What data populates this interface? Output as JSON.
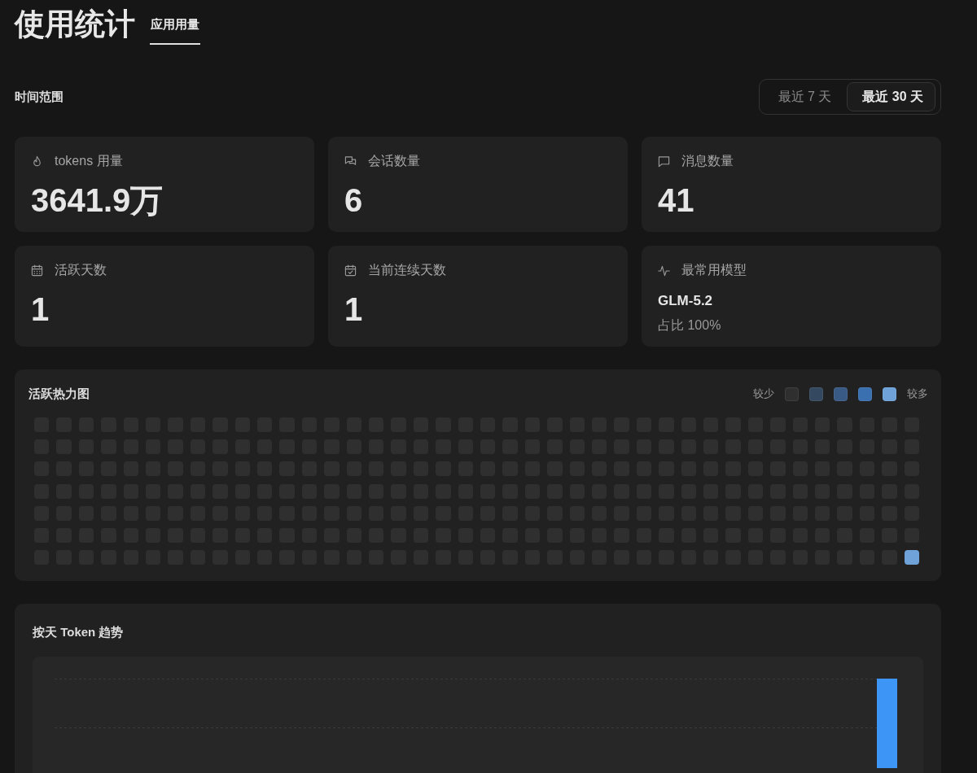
{
  "page": {
    "title": "使用统计"
  },
  "tabs": [
    {
      "label": "应用用量",
      "selected": true
    }
  ],
  "time_range": {
    "label": "时间范围",
    "options": [
      {
        "label": "最近 7 天",
        "selected": false
      },
      {
        "label": "最近 30 天",
        "selected": true
      }
    ]
  },
  "stat_cards": [
    {
      "kind": "count",
      "label": "tokens 用量",
      "value": "3641.9万"
    },
    {
      "kind": "count",
      "label": "会话数量",
      "value": "6"
    },
    {
      "kind": "count",
      "label": "消息数量",
      "value": "41"
    },
    {
      "kind": "count",
      "label": "活跃天数",
      "value": "1"
    },
    {
      "kind": "count",
      "label": "当前连续天数",
      "value": "1"
    },
    {
      "kind": "model",
      "label": "最常用模型",
      "model": "GLM-5.2",
      "share": "占比 100%"
    }
  ],
  "heatmap": {
    "title": "活跃热力图",
    "legend": {
      "less": "较少",
      "more": "较多",
      "swatches": [
        {
          "color": "#2f2f2f"
        },
        {
          "color": "#34495f"
        },
        {
          "color": "#395a85"
        },
        {
          "color": "#3a6fb0"
        },
        {
          "color": "#6ea2d9"
        }
      ]
    },
    "columns": [
      {
        "cells": [
          {
            "color": "#2f2f2f"
          },
          {
            "color": "#2f2f2f"
          },
          {
            "color": "#2f2f2f"
          },
          {
            "color": "#2f2f2f"
          },
          {
            "color": "#2f2f2f"
          },
          {
            "color": "#2f2f2f"
          },
          {
            "color": "#2f2f2f"
          }
        ]
      },
      {
        "cells": [
          {
            "color": "#2f2f2f"
          },
          {
            "color": "#2f2f2f"
          },
          {
            "color": "#2f2f2f"
          },
          {
            "color": "#2f2f2f"
          },
          {
            "color": "#2f2f2f"
          },
          {
            "color": "#2f2f2f"
          },
          {
            "color": "#2f2f2f"
          }
        ]
      },
      {
        "cells": [
          {
            "color": "#2f2f2f"
          },
          {
            "color": "#2f2f2f"
          },
          {
            "color": "#2f2f2f"
          },
          {
            "color": "#2f2f2f"
          },
          {
            "color": "#2f2f2f"
          },
          {
            "color": "#2f2f2f"
          },
          {
            "color": "#2f2f2f"
          }
        ]
      },
      {
        "cells": [
          {
            "color": "#2f2f2f"
          },
          {
            "color": "#2f2f2f"
          },
          {
            "color": "#2f2f2f"
          },
          {
            "color": "#2f2f2f"
          },
          {
            "color": "#2f2f2f"
          },
          {
            "color": "#2f2f2f"
          },
          {
            "color": "#2f2f2f"
          }
        ]
      },
      {
        "cells": [
          {
            "color": "#2f2f2f"
          },
          {
            "color": "#2f2f2f"
          },
          {
            "color": "#2f2f2f"
          },
          {
            "color": "#2f2f2f"
          },
          {
            "color": "#2f2f2f"
          },
          {
            "color": "#2f2f2f"
          },
          {
            "color": "#2f2f2f"
          }
        ]
      },
      {
        "cells": [
          {
            "color": "#2f2f2f"
          },
          {
            "color": "#2f2f2f"
          },
          {
            "color": "#2f2f2f"
          },
          {
            "color": "#2f2f2f"
          },
          {
            "color": "#2f2f2f"
          },
          {
            "color": "#2f2f2f"
          },
          {
            "color": "#2f2f2f"
          }
        ]
      },
      {
        "cells": [
          {
            "color": "#2f2f2f"
          },
          {
            "color": "#2f2f2f"
          },
          {
            "color": "#2f2f2f"
          },
          {
            "color": "#2f2f2f"
          },
          {
            "color": "#2f2f2f"
          },
          {
            "color": "#2f2f2f"
          },
          {
            "color": "#2f2f2f"
          }
        ]
      },
      {
        "cells": [
          {
            "color": "#2f2f2f"
          },
          {
            "color": "#2f2f2f"
          },
          {
            "color": "#2f2f2f"
          },
          {
            "color": "#2f2f2f"
          },
          {
            "color": "#2f2f2f"
          },
          {
            "color": "#2f2f2f"
          },
          {
            "color": "#2f2f2f"
          }
        ]
      },
      {
        "cells": [
          {
            "color": "#2f2f2f"
          },
          {
            "color": "#2f2f2f"
          },
          {
            "color": "#2f2f2f"
          },
          {
            "color": "#2f2f2f"
          },
          {
            "color": "#2f2f2f"
          },
          {
            "color": "#2f2f2f"
          },
          {
            "color": "#2f2f2f"
          }
        ]
      },
      {
        "cells": [
          {
            "color": "#2f2f2f"
          },
          {
            "color": "#2f2f2f"
          },
          {
            "color": "#2f2f2f"
          },
          {
            "color": "#2f2f2f"
          },
          {
            "color": "#2f2f2f"
          },
          {
            "color": "#2f2f2f"
          },
          {
            "color": "#2f2f2f"
          }
        ]
      },
      {
        "cells": [
          {
            "color": "#2f2f2f"
          },
          {
            "color": "#2f2f2f"
          },
          {
            "color": "#2f2f2f"
          },
          {
            "color": "#2f2f2f"
          },
          {
            "color": "#2f2f2f"
          },
          {
            "color": "#2f2f2f"
          },
          {
            "color": "#2f2f2f"
          }
        ]
      },
      {
        "cells": [
          {
            "color": "#2f2f2f"
          },
          {
            "color": "#2f2f2f"
          },
          {
            "color": "#2f2f2f"
          },
          {
            "color": "#2f2f2f"
          },
          {
            "color": "#2f2f2f"
          },
          {
            "color": "#2f2f2f"
          },
          {
            "color": "#2f2f2f"
          }
        ]
      },
      {
        "cells": [
          {
            "color": "#2f2f2f"
          },
          {
            "color": "#2f2f2f"
          },
          {
            "color": "#2f2f2f"
          },
          {
            "color": "#2f2f2f"
          },
          {
            "color": "#2f2f2f"
          },
          {
            "color": "#2f2f2f"
          },
          {
            "color": "#2f2f2f"
          }
        ]
      },
      {
        "cells": [
          {
            "color": "#2f2f2f"
          },
          {
            "color": "#2f2f2f"
          },
          {
            "color": "#2f2f2f"
          },
          {
            "color": "#2f2f2f"
          },
          {
            "color": "#2f2f2f"
          },
          {
            "color": "#2f2f2f"
          },
          {
            "color": "#2f2f2f"
          }
        ]
      },
      {
        "cells": [
          {
            "color": "#2f2f2f"
          },
          {
            "color": "#2f2f2f"
          },
          {
            "color": "#2f2f2f"
          },
          {
            "color": "#2f2f2f"
          },
          {
            "color": "#2f2f2f"
          },
          {
            "color": "#2f2f2f"
          },
          {
            "color": "#2f2f2f"
          }
        ]
      },
      {
        "cells": [
          {
            "color": "#2f2f2f"
          },
          {
            "color": "#2f2f2f"
          },
          {
            "color": "#2f2f2f"
          },
          {
            "color": "#2f2f2f"
          },
          {
            "color": "#2f2f2f"
          },
          {
            "color": "#2f2f2f"
          },
          {
            "color": "#2f2f2f"
          }
        ]
      },
      {
        "cells": [
          {
            "color": "#2f2f2f"
          },
          {
            "color": "#2f2f2f"
          },
          {
            "color": "#2f2f2f"
          },
          {
            "color": "#2f2f2f"
          },
          {
            "color": "#2f2f2f"
          },
          {
            "color": "#2f2f2f"
          },
          {
            "color": "#2f2f2f"
          }
        ]
      },
      {
        "cells": [
          {
            "color": "#2f2f2f"
          },
          {
            "color": "#2f2f2f"
          },
          {
            "color": "#2f2f2f"
          },
          {
            "color": "#2f2f2f"
          },
          {
            "color": "#2f2f2f"
          },
          {
            "color": "#2f2f2f"
          },
          {
            "color": "#2f2f2f"
          }
        ]
      },
      {
        "cells": [
          {
            "color": "#2f2f2f"
          },
          {
            "color": "#2f2f2f"
          },
          {
            "color": "#2f2f2f"
          },
          {
            "color": "#2f2f2f"
          },
          {
            "color": "#2f2f2f"
          },
          {
            "color": "#2f2f2f"
          },
          {
            "color": "#2f2f2f"
          }
        ]
      },
      {
        "cells": [
          {
            "color": "#2f2f2f"
          },
          {
            "color": "#2f2f2f"
          },
          {
            "color": "#2f2f2f"
          },
          {
            "color": "#2f2f2f"
          },
          {
            "color": "#2f2f2f"
          },
          {
            "color": "#2f2f2f"
          },
          {
            "color": "#2f2f2f"
          }
        ]
      },
      {
        "cells": [
          {
            "color": "#2f2f2f"
          },
          {
            "color": "#2f2f2f"
          },
          {
            "color": "#2f2f2f"
          },
          {
            "color": "#2f2f2f"
          },
          {
            "color": "#2f2f2f"
          },
          {
            "color": "#2f2f2f"
          },
          {
            "color": "#2f2f2f"
          }
        ]
      },
      {
        "cells": [
          {
            "color": "#2f2f2f"
          },
          {
            "color": "#2f2f2f"
          },
          {
            "color": "#2f2f2f"
          },
          {
            "color": "#2f2f2f"
          },
          {
            "color": "#2f2f2f"
          },
          {
            "color": "#2f2f2f"
          },
          {
            "color": "#2f2f2f"
          }
        ]
      },
      {
        "cells": [
          {
            "color": "#2f2f2f"
          },
          {
            "color": "#2f2f2f"
          },
          {
            "color": "#2f2f2f"
          },
          {
            "color": "#2f2f2f"
          },
          {
            "color": "#2f2f2f"
          },
          {
            "color": "#2f2f2f"
          },
          {
            "color": "#2f2f2f"
          }
        ]
      },
      {
        "cells": [
          {
            "color": "#2f2f2f"
          },
          {
            "color": "#2f2f2f"
          },
          {
            "color": "#2f2f2f"
          },
          {
            "color": "#2f2f2f"
          },
          {
            "color": "#2f2f2f"
          },
          {
            "color": "#2f2f2f"
          },
          {
            "color": "#2f2f2f"
          }
        ]
      },
      {
        "cells": [
          {
            "color": "#2f2f2f"
          },
          {
            "color": "#2f2f2f"
          },
          {
            "color": "#2f2f2f"
          },
          {
            "color": "#2f2f2f"
          },
          {
            "color": "#2f2f2f"
          },
          {
            "color": "#2f2f2f"
          },
          {
            "color": "#2f2f2f"
          }
        ]
      },
      {
        "cells": [
          {
            "color": "#2f2f2f"
          },
          {
            "color": "#2f2f2f"
          },
          {
            "color": "#2f2f2f"
          },
          {
            "color": "#2f2f2f"
          },
          {
            "color": "#2f2f2f"
          },
          {
            "color": "#2f2f2f"
          },
          {
            "color": "#2f2f2f"
          }
        ]
      },
      {
        "cells": [
          {
            "color": "#2f2f2f"
          },
          {
            "color": "#2f2f2f"
          },
          {
            "color": "#2f2f2f"
          },
          {
            "color": "#2f2f2f"
          },
          {
            "color": "#2f2f2f"
          },
          {
            "color": "#2f2f2f"
          },
          {
            "color": "#2f2f2f"
          }
        ]
      },
      {
        "cells": [
          {
            "color": "#2f2f2f"
          },
          {
            "color": "#2f2f2f"
          },
          {
            "color": "#2f2f2f"
          },
          {
            "color": "#2f2f2f"
          },
          {
            "color": "#2f2f2f"
          },
          {
            "color": "#2f2f2f"
          },
          {
            "color": "#2f2f2f"
          }
        ]
      },
      {
        "cells": [
          {
            "color": "#2f2f2f"
          },
          {
            "color": "#2f2f2f"
          },
          {
            "color": "#2f2f2f"
          },
          {
            "color": "#2f2f2f"
          },
          {
            "color": "#2f2f2f"
          },
          {
            "color": "#2f2f2f"
          },
          {
            "color": "#2f2f2f"
          }
        ]
      },
      {
        "cells": [
          {
            "color": "#2f2f2f"
          },
          {
            "color": "#2f2f2f"
          },
          {
            "color": "#2f2f2f"
          },
          {
            "color": "#2f2f2f"
          },
          {
            "color": "#2f2f2f"
          },
          {
            "color": "#2f2f2f"
          },
          {
            "color": "#2f2f2f"
          }
        ]
      },
      {
        "cells": [
          {
            "color": "#2f2f2f"
          },
          {
            "color": "#2f2f2f"
          },
          {
            "color": "#2f2f2f"
          },
          {
            "color": "#2f2f2f"
          },
          {
            "color": "#2f2f2f"
          },
          {
            "color": "#2f2f2f"
          },
          {
            "color": "#2f2f2f"
          }
        ]
      },
      {
        "cells": [
          {
            "color": "#2f2f2f"
          },
          {
            "color": "#2f2f2f"
          },
          {
            "color": "#2f2f2f"
          },
          {
            "color": "#2f2f2f"
          },
          {
            "color": "#2f2f2f"
          },
          {
            "color": "#2f2f2f"
          },
          {
            "color": "#2f2f2f"
          }
        ]
      },
      {
        "cells": [
          {
            "color": "#2f2f2f"
          },
          {
            "color": "#2f2f2f"
          },
          {
            "color": "#2f2f2f"
          },
          {
            "color": "#2f2f2f"
          },
          {
            "color": "#2f2f2f"
          },
          {
            "color": "#2f2f2f"
          },
          {
            "color": "#2f2f2f"
          }
        ]
      },
      {
        "cells": [
          {
            "color": "#2f2f2f"
          },
          {
            "color": "#2f2f2f"
          },
          {
            "color": "#2f2f2f"
          },
          {
            "color": "#2f2f2f"
          },
          {
            "color": "#2f2f2f"
          },
          {
            "color": "#2f2f2f"
          },
          {
            "color": "#2f2f2f"
          }
        ]
      },
      {
        "cells": [
          {
            "color": "#2f2f2f"
          },
          {
            "color": "#2f2f2f"
          },
          {
            "color": "#2f2f2f"
          },
          {
            "color": "#2f2f2f"
          },
          {
            "color": "#2f2f2f"
          },
          {
            "color": "#2f2f2f"
          },
          {
            "color": "#2f2f2f"
          }
        ]
      },
      {
        "cells": [
          {
            "color": "#2f2f2f"
          },
          {
            "color": "#2f2f2f"
          },
          {
            "color": "#2f2f2f"
          },
          {
            "color": "#2f2f2f"
          },
          {
            "color": "#2f2f2f"
          },
          {
            "color": "#2f2f2f"
          },
          {
            "color": "#2f2f2f"
          }
        ]
      },
      {
        "cells": [
          {
            "color": "#2f2f2f"
          },
          {
            "color": "#2f2f2f"
          },
          {
            "color": "#2f2f2f"
          },
          {
            "color": "#2f2f2f"
          },
          {
            "color": "#2f2f2f"
          },
          {
            "color": "#2f2f2f"
          },
          {
            "color": "#2f2f2f"
          }
        ]
      },
      {
        "cells": [
          {
            "color": "#2f2f2f"
          },
          {
            "color": "#2f2f2f"
          },
          {
            "color": "#2f2f2f"
          },
          {
            "color": "#2f2f2f"
          },
          {
            "color": "#2f2f2f"
          },
          {
            "color": "#2f2f2f"
          },
          {
            "color": "#2f2f2f"
          }
        ]
      },
      {
        "cells": [
          {
            "color": "#2f2f2f"
          },
          {
            "color": "#2f2f2f"
          },
          {
            "color": "#2f2f2f"
          },
          {
            "color": "#2f2f2f"
          },
          {
            "color": "#2f2f2f"
          },
          {
            "color": "#2f2f2f"
          },
          {
            "color": "#2f2f2f"
          }
        ]
      },
      {
        "cells": [
          {
            "color": "#2f2f2f"
          },
          {
            "color": "#2f2f2f"
          },
          {
            "color": "#2f2f2f"
          },
          {
            "color": "#2f2f2f"
          },
          {
            "color": "#2f2f2f"
          },
          {
            "color": "#2f2f2f"
          },
          {
            "color": "#6ea2d9"
          }
        ]
      }
    ]
  },
  "token_trend": {
    "title": "按天 Token 趋势"
  }
}
